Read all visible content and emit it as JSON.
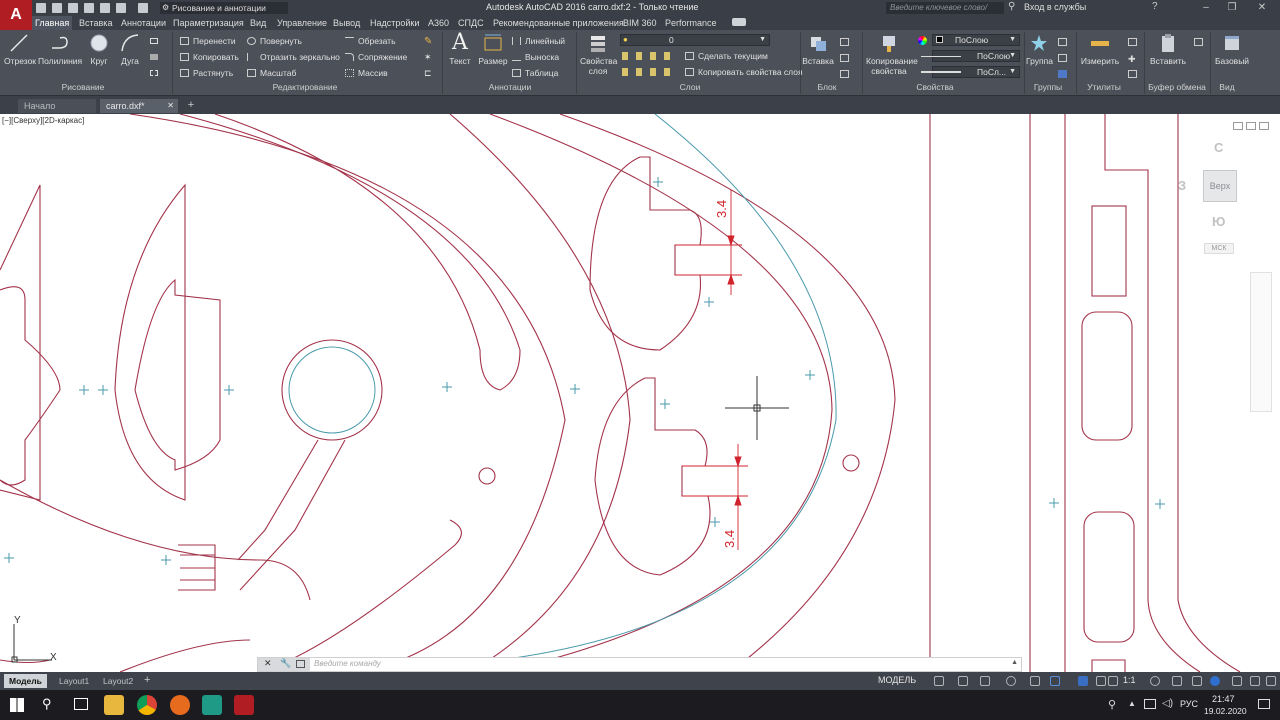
{
  "app": {
    "logo_letter": "A",
    "window_title": "Autodesk AutoCAD 2016    carro.dxf:2 - Только чтение",
    "workspace": "Рисование и аннотации",
    "search_placeholder": "Введите ключевое слово/фразу",
    "signin": "Вход в службы"
  },
  "ribbon_tabs": [
    "Главная",
    "Вставка",
    "Аннотации",
    "Параметризация",
    "Вид",
    "Управление",
    "Вывод",
    "Надстройки",
    "A360",
    "СПДС",
    "Рекомендованные приложения",
    "BIM 360",
    "Performance"
  ],
  "ribbon": {
    "draw": {
      "title": "Рисование",
      "line": "Отрезок",
      "polyline": "Полилиния",
      "circle": "Круг",
      "arc": "Дуга"
    },
    "modify": {
      "title": "Редактирование",
      "move": "Перенести",
      "rotate": "Повернуть",
      "trim": "Обрезать",
      "copy": "Копировать",
      "mirror": "Отразить зеркально",
      "fillet": "Сопряжение",
      "stretch": "Растянуть",
      "scale": "Масштаб",
      "array": "Массив"
    },
    "annotation": {
      "title": "Аннотации",
      "text": "Текст",
      "dimension": "Размер",
      "linear": "Линейный",
      "leader": "Выноска",
      "table": "Таблица"
    },
    "layers": {
      "title": "Слои",
      "layer_props_line1": "Свойства",
      "layer_props_line2": "слоя",
      "current_layer": "0",
      "make_current": "Сделать текущим",
      "match_layer": "Копировать свойства слоя"
    },
    "block": {
      "title": "Блок",
      "insert": "Вставка"
    },
    "properties": {
      "title": "Свойства",
      "match_line1": "Копирование",
      "match_line2": "свойства",
      "color": "ПоСлою",
      "linetype": "ПоСлою",
      "lineweight": "ПоСл..."
    },
    "groups": {
      "title": "Группы",
      "group": "Группа"
    },
    "utilities": {
      "title": "Утилиты",
      "measure": "Измерить"
    },
    "clipboard": {
      "title": "Буфер обмена",
      "paste": "Вставить"
    },
    "view": {
      "title": "Вид",
      "base": "Базовый"
    }
  },
  "file_tabs": [
    "Начало",
    "carro.dxf*"
  ],
  "viewport": {
    "label": "[−][Сверху][2D-каркас]",
    "dim_upper": "3.4",
    "dim_lower": "3.4",
    "ucs_y": "Y",
    "ucs_x": "X"
  },
  "viewcube": {
    "north": "С",
    "south": "Ю",
    "west": "З",
    "top": "Верх",
    "wcs": "МСК"
  },
  "command_line": {
    "placeholder": "Введите команду"
  },
  "layout_tabs": [
    "Модель",
    "Layout1",
    "Layout2"
  ],
  "status": {
    "model": "МОДЕЛЬ",
    "scale": "1:1"
  },
  "taskbar": {
    "language": "РУС",
    "time": "21:47",
    "date": "19.02.2020"
  },
  "colors": {
    "geometry": "#a3334a",
    "construction": "#4a9aab",
    "dimension": "#d0232c",
    "ribbon_bg": "#4b5059",
    "title_bg": "#3a3f47"
  }
}
